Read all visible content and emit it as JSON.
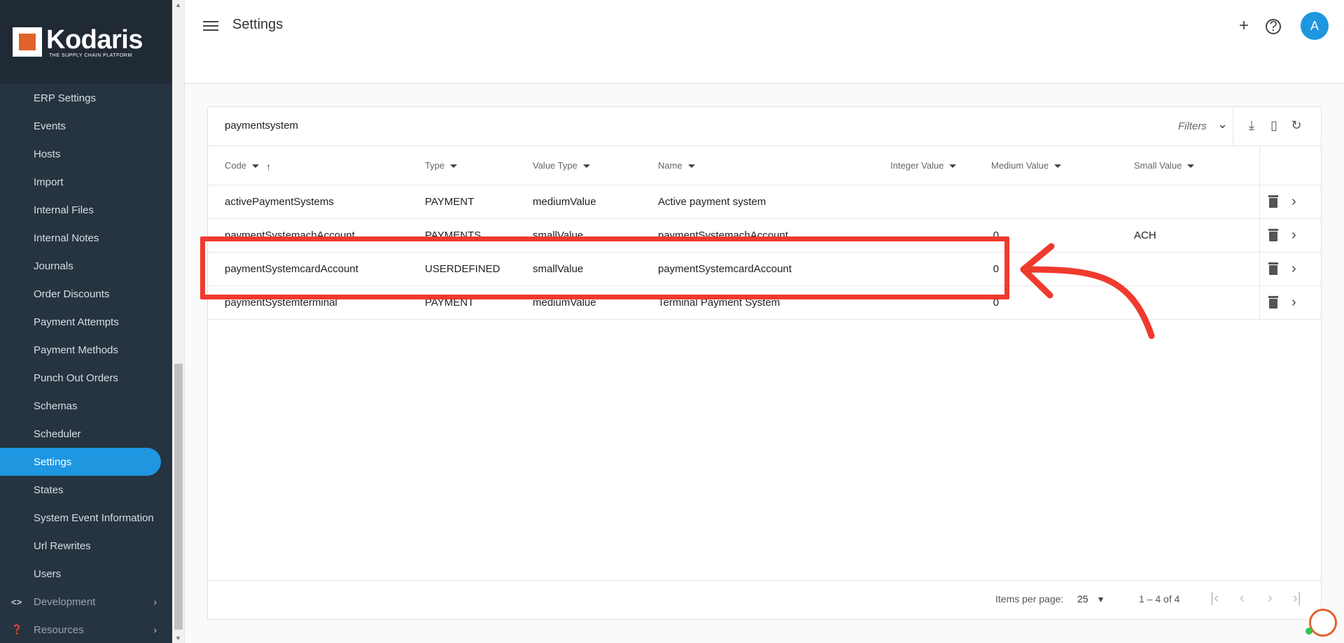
{
  "brand": {
    "name": "Kodaris",
    "tagline": "THE SUPPLY CHAIN PLATFORM"
  },
  "sidebar": {
    "items": [
      {
        "label": "ERP Settings"
      },
      {
        "label": "Events"
      },
      {
        "label": "Hosts"
      },
      {
        "label": "Import"
      },
      {
        "label": "Internal Files"
      },
      {
        "label": "Internal Notes"
      },
      {
        "label": "Journals"
      },
      {
        "label": "Order Discounts"
      },
      {
        "label": "Payment Attempts"
      },
      {
        "label": "Payment Methods"
      },
      {
        "label": "Punch Out Orders"
      },
      {
        "label": "Schemas"
      },
      {
        "label": "Scheduler"
      },
      {
        "label": "Settings"
      },
      {
        "label": "States"
      },
      {
        "label": "System Event Information"
      },
      {
        "label": "Url Rewrites"
      },
      {
        "label": "Users"
      }
    ],
    "groups": [
      {
        "label": "Development",
        "icon": "code-icon"
      },
      {
        "label": "Resources",
        "icon": "help-circle-icon"
      }
    ],
    "active": "Settings"
  },
  "header": {
    "title": "Settings",
    "avatar_initial": "A"
  },
  "toolbar": {
    "search_value": "paymentsystem",
    "filters_label": "Filters"
  },
  "table": {
    "columns": [
      "Code",
      "Type",
      "Value Type",
      "Name",
      "Integer Value",
      "Medium Value",
      "Small Value"
    ],
    "rows": [
      {
        "code": "activePaymentSystems",
        "type": "PAYMENT",
        "value_type": "mediumValue",
        "name": "Active payment system",
        "integer_value": "",
        "medium_value": "",
        "small_value": ""
      },
      {
        "code": "paymentSystemachAccount",
        "type": "PAYMENTS",
        "value_type": "smallValue",
        "name": "paymentSystemachAccount",
        "integer_value": "0",
        "medium_value": "",
        "small_value": "ACH"
      },
      {
        "code": "paymentSystemcardAccount",
        "type": "USERDEFINED",
        "value_type": "smallValue",
        "name": "paymentSystemcardAccount",
        "integer_value": "0",
        "medium_value": "",
        "small_value": ""
      },
      {
        "code": "paymentSystemterminal",
        "type": "PAYMENT",
        "value_type": "mediumValue",
        "name": "Terminal Payment System",
        "integer_value": "0",
        "medium_value": "",
        "small_value": ""
      }
    ]
  },
  "paginator": {
    "items_per_page_label": "Items per page:",
    "page_size": "25",
    "range": "1 – 4 of 4"
  },
  "colors": {
    "accent": "#1e96e0",
    "sidebar_bg": "#263340",
    "annotation": "#f03a2e",
    "brand_orange": "#e0632b"
  }
}
